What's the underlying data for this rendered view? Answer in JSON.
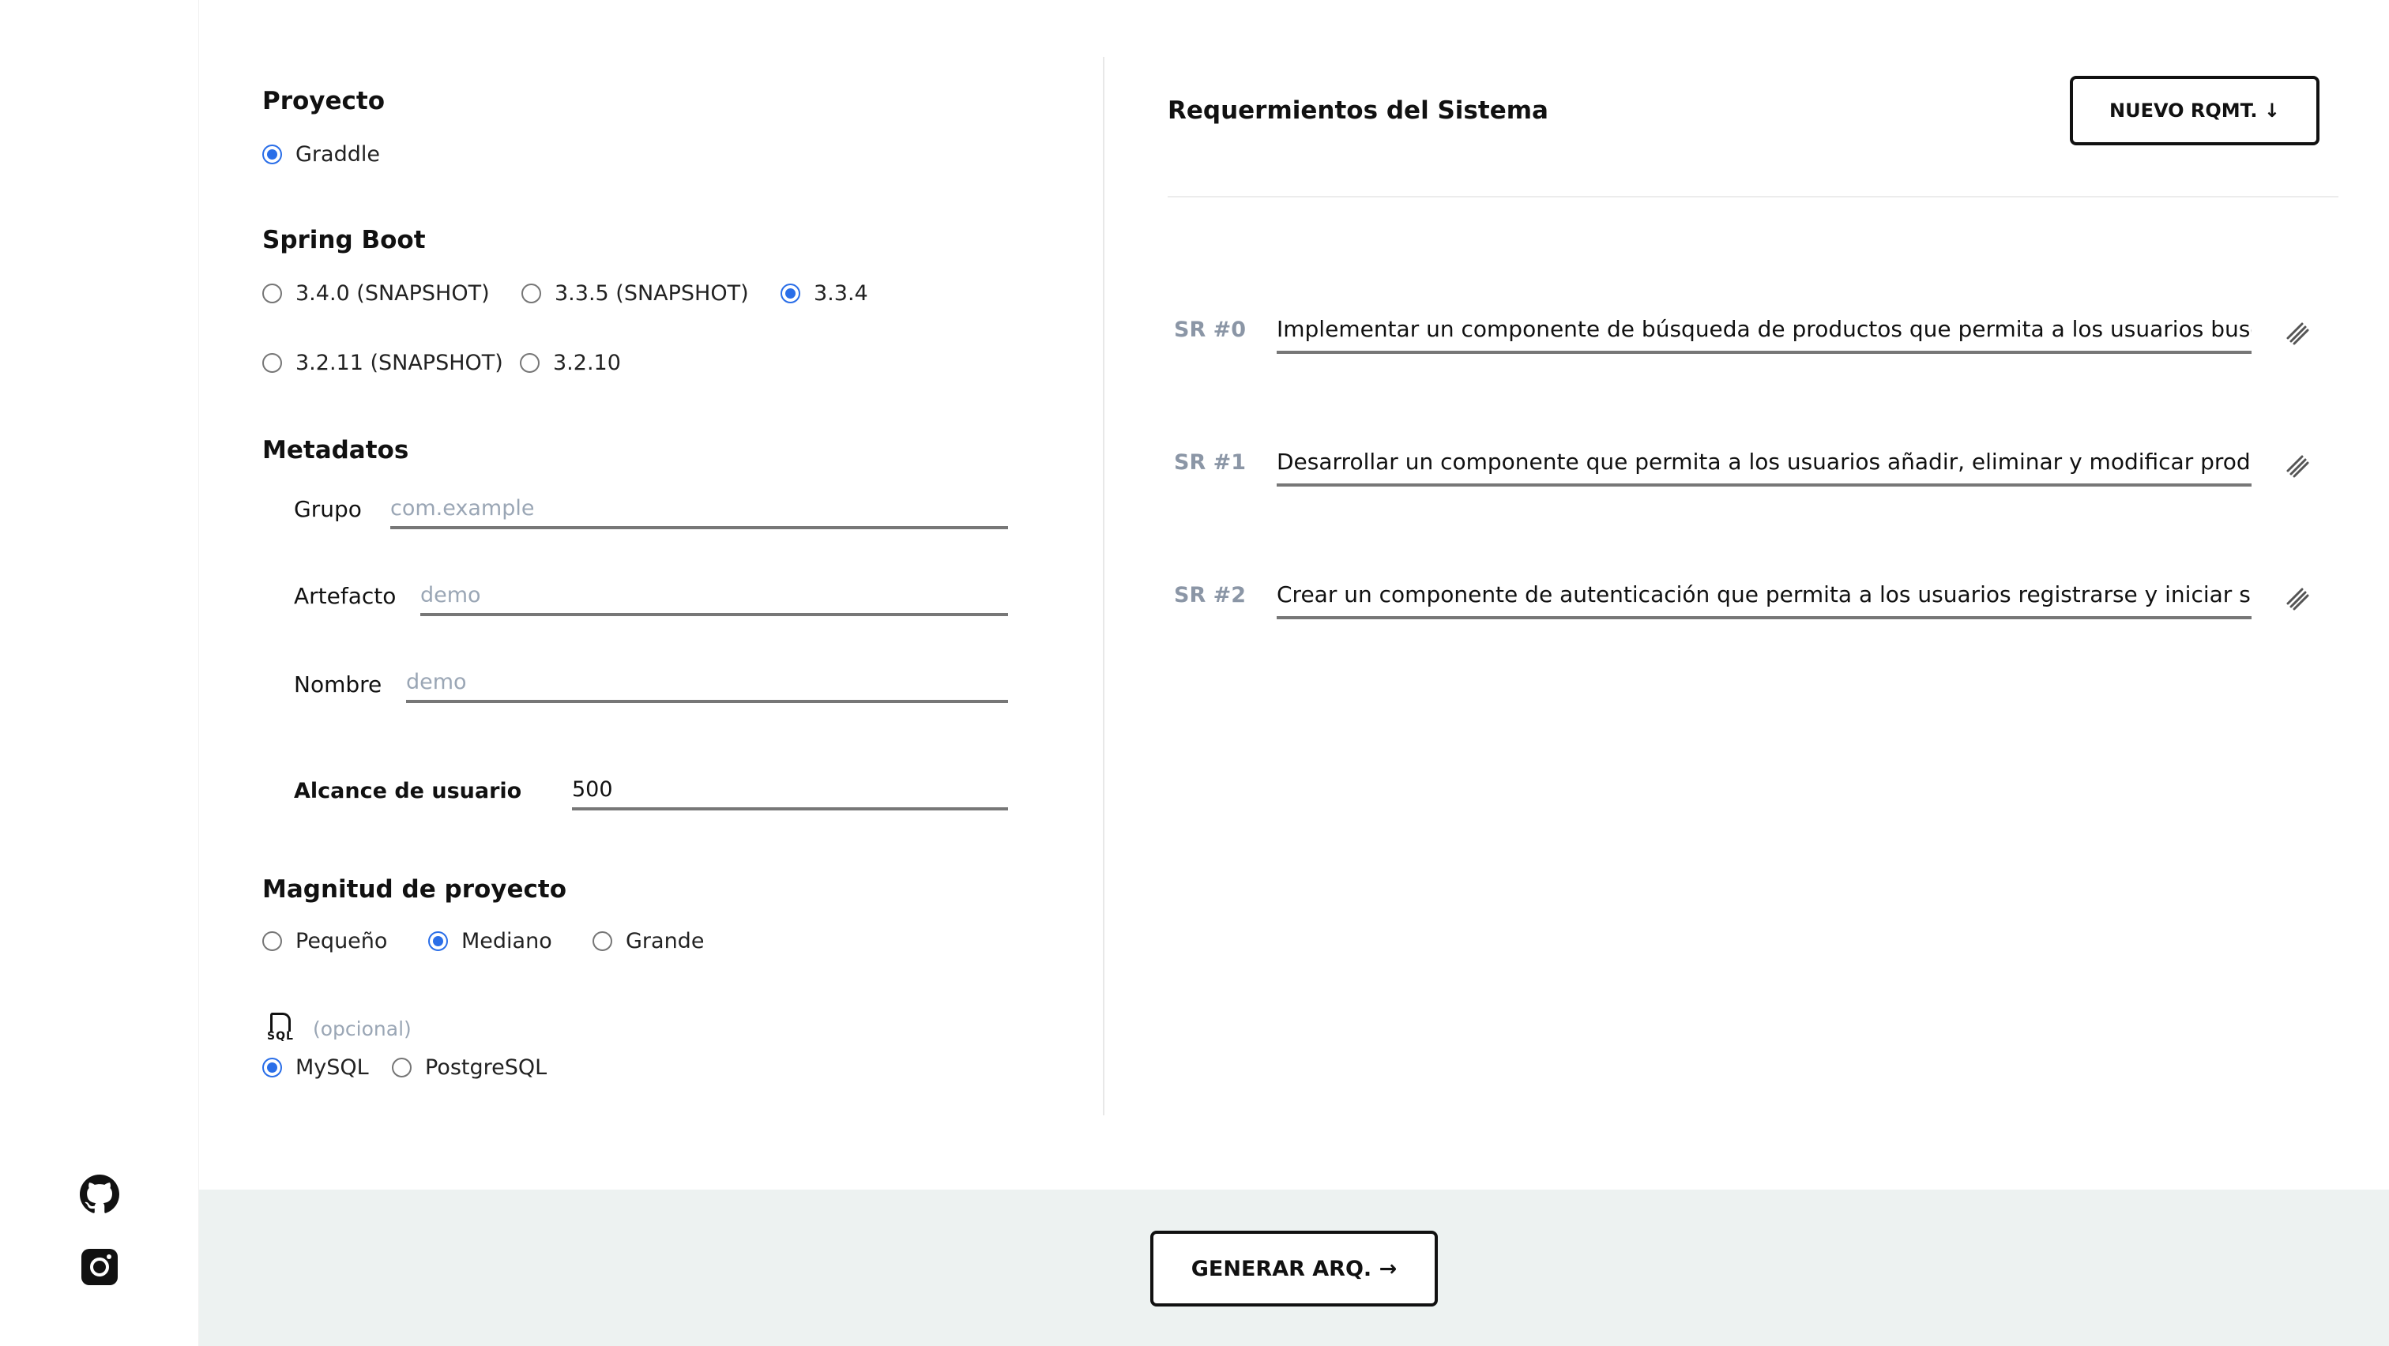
{
  "proyecto": {
    "title": "Proyecto",
    "options": [
      {
        "label": "Graddle",
        "checked": true
      }
    ]
  },
  "spring_boot": {
    "title": "Spring Boot",
    "options": [
      {
        "label": "3.4.0 (SNAPSHOT)",
        "checked": false
      },
      {
        "label": "3.3.5 (SNAPSHOT)",
        "checked": false
      },
      {
        "label": "3.3.4",
        "checked": true
      },
      {
        "label": "3.2.11 (SNAPSHOT)",
        "checked": false
      },
      {
        "label": "3.2.10",
        "checked": false
      }
    ]
  },
  "metadatos": {
    "title": "Metadatos",
    "grupo": {
      "label": "Grupo",
      "placeholder": "com.example",
      "value": ""
    },
    "artefacto": {
      "label": "Artefacto",
      "placeholder": "demo",
      "value": ""
    },
    "nombre": {
      "label": "Nombre",
      "placeholder": "demo",
      "value": ""
    },
    "alcance": {
      "label": "Alcance de usuario",
      "value": "500"
    }
  },
  "magnitud": {
    "title": "Magnitud de proyecto",
    "options": [
      {
        "label": "Pequeño",
        "checked": false
      },
      {
        "label": "Mediano",
        "checked": true
      },
      {
        "label": "Grande",
        "checked": false
      }
    ]
  },
  "database": {
    "icon": "sql-file-icon",
    "icon_text": "SQL",
    "optional_label": "(opcional)",
    "options": [
      {
        "label": "MySQL",
        "checked": true
      },
      {
        "label": "PostgreSQL",
        "checked": false
      }
    ]
  },
  "requirements": {
    "title": "Requermientos del Sistema",
    "new_button": "NUEVO RQMT. ↓",
    "items": [
      {
        "id": "SR #0",
        "text": "Implementar un componente de búsqueda de productos que permita a los usuarios buscar pro"
      },
      {
        "id": "SR #1",
        "text": "Desarrollar un componente que permita a los usuarios añadir, eliminar y modificar productos en"
      },
      {
        "id": "SR #2",
        "text": "Crear un componente de autenticación que permita a los usuarios registrarse y iniciar sesión, v"
      }
    ]
  },
  "footer": {
    "generate_button": "GENERAR ARQ. →"
  },
  "rail": {
    "icons": [
      "github-icon",
      "instagram-icon"
    ]
  },
  "colors": {
    "accent": "#2a6ee8",
    "bottom_bar": "#edf2f1",
    "muted": "#9aa6b5"
  }
}
